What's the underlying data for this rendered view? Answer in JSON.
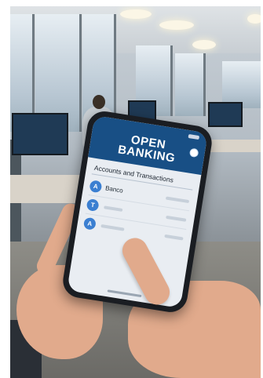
{
  "app": {
    "title_line1": "OPEN",
    "title_line2": "BANKING",
    "section_title": "Accounts and Transactions"
  },
  "accounts": [
    {
      "badge": "A",
      "label": "Banco"
    },
    {
      "badge": "T",
      "label": ""
    },
    {
      "badge": "A",
      "label": ""
    }
  ],
  "icons": {
    "profile": "user-circle-icon"
  },
  "colors": {
    "header": "#184f85",
    "badge": "#3b7fd1",
    "screen_bg": "#e9edf2"
  }
}
